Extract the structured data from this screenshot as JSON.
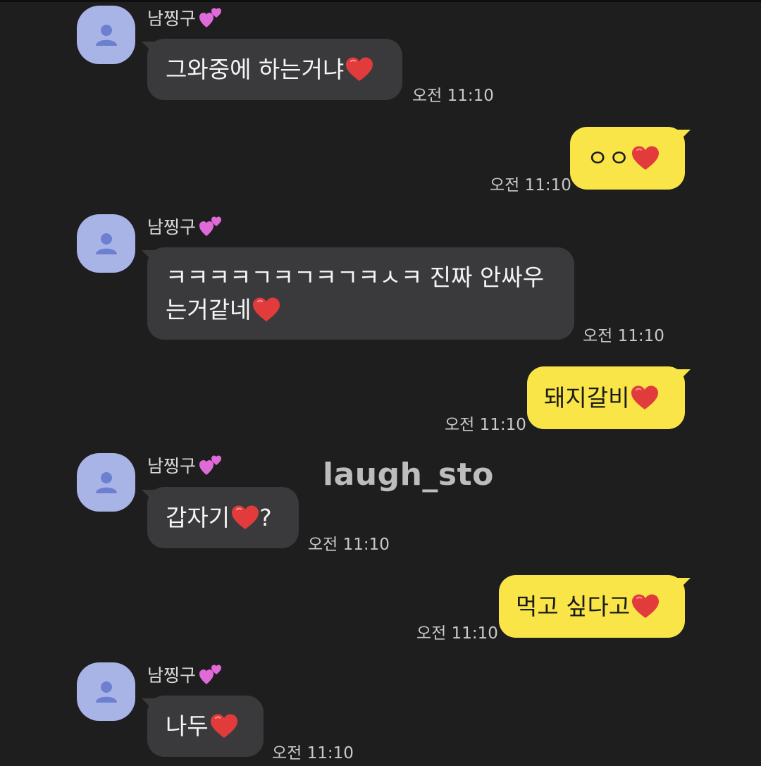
{
  "watermark": "laugh_sto",
  "colors": {
    "background": "#1e1e1f",
    "incoming_bubble": "#3a3a3c",
    "outgoing_bubble": "#f9e547",
    "avatar": "#a9b4e6",
    "heart": "#e23b3b"
  },
  "messages": [
    {
      "direction": "in",
      "sender": "남찡구",
      "sender_emoji": "two-hearts-icon",
      "text": "그와중에 하는거냐",
      "emoji": "heart-icon",
      "time": "오전 11:10"
    },
    {
      "direction": "out",
      "text": "ㅇㅇ",
      "emoji": "heart-icon",
      "time": "오전 11:10"
    },
    {
      "direction": "in",
      "sender": "남찡구",
      "sender_emoji": "two-hearts-icon",
      "line1": "ㅋㅋㅋㅋㄱㅋㄱㅋㄱㅋㅅㅋ 진짜 안싸우",
      "line2": "는거같네",
      "emoji": "heart-icon",
      "time": "오전 11:10"
    },
    {
      "direction": "out",
      "text": "돼지갈비",
      "emoji": "heart-icon",
      "time": "오전 11:10"
    },
    {
      "direction": "in",
      "sender": "남찡구",
      "sender_emoji": "two-hearts-icon",
      "text": "갑자기",
      "emoji": "heart-icon",
      "suffix": "?",
      "time": "오전 11:10"
    },
    {
      "direction": "out",
      "text": "먹고 싶다고",
      "emoji": "heart-icon",
      "time": "오전 11:10"
    },
    {
      "direction": "in",
      "sender": "남찡구",
      "sender_emoji": "two-hearts-icon",
      "text": "나두",
      "emoji": "heart-icon",
      "time": "오전 11:10"
    }
  ]
}
